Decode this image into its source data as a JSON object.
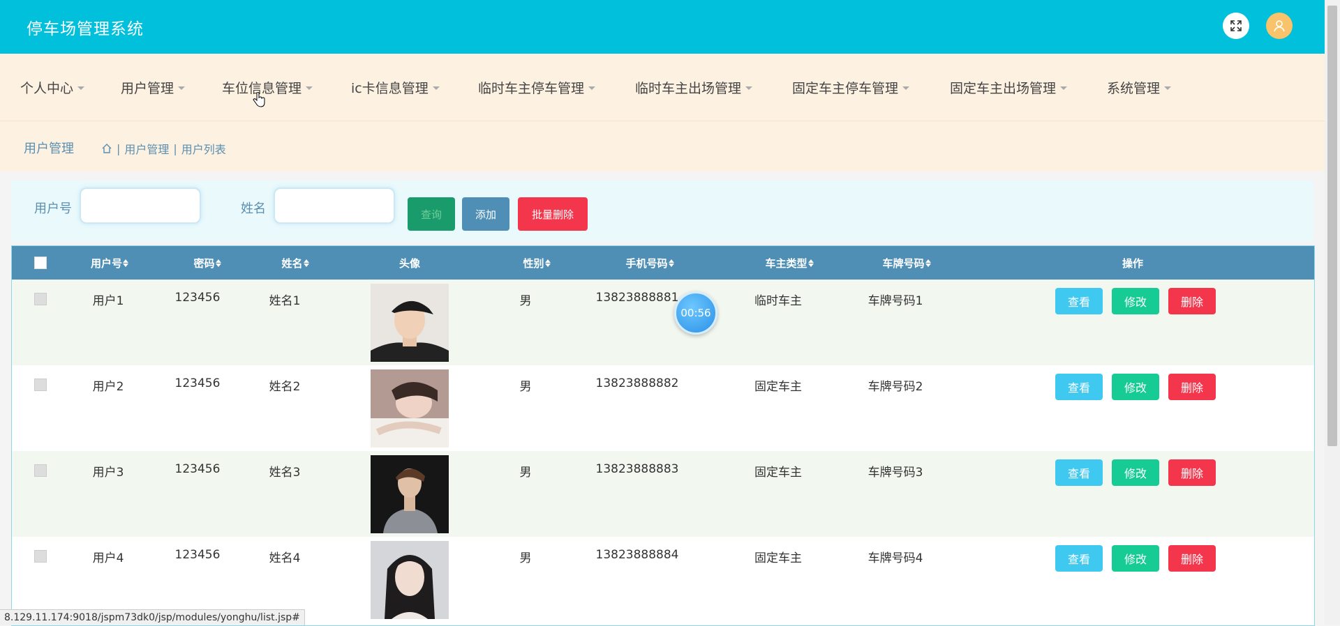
{
  "app": {
    "title": "停车场管理系统"
  },
  "menu": [
    {
      "label": "个人中心"
    },
    {
      "label": "用户管理"
    },
    {
      "label": "车位信息管理"
    },
    {
      "label": "ic卡信息管理"
    },
    {
      "label": "临时车主停车管理"
    },
    {
      "label": "临时车主出场管理"
    },
    {
      "label": "固定车主停车管理"
    },
    {
      "label": "固定车主出场管理"
    },
    {
      "label": "系统管理"
    }
  ],
  "breadcrumb": {
    "title": "用户管理",
    "path1": "用户管理",
    "path2": "用户列表"
  },
  "search": {
    "user_label": "用户号",
    "user_value": "",
    "name_label": "姓名",
    "name_value": "",
    "query_label": "查询",
    "add_label": "添加",
    "batch_delete_label": "批量删除"
  },
  "table": {
    "headers": [
      "用户号",
      "密码",
      "姓名",
      "头像",
      "性别",
      "手机号码",
      "车主类型",
      "车牌号码",
      "操作"
    ],
    "rows": [
      {
        "user": "用户1",
        "password": "123456",
        "name": "姓名1",
        "gender": "男",
        "phone": "13823888881",
        "type": "临时车主",
        "plate": "车牌号码1"
      },
      {
        "user": "用户2",
        "password": "123456",
        "name": "姓名2",
        "gender": "男",
        "phone": "13823888882",
        "type": "固定车主",
        "plate": "车牌号码2"
      },
      {
        "user": "用户3",
        "password": "123456",
        "name": "姓名3",
        "gender": "男",
        "phone": "13823888883",
        "type": "固定车主",
        "plate": "车牌号码3"
      },
      {
        "user": "用户4",
        "password": "123456",
        "name": "姓名4",
        "gender": "男",
        "phone": "13823888884",
        "type": "固定车主",
        "plate": "车牌号码4"
      }
    ],
    "actions": {
      "view": "查看",
      "edit": "修改",
      "delete": "删除"
    }
  },
  "timer": {
    "text": "00:56"
  },
  "status_url": "8.129.11.174:9018/jspm73dk0/jsp/modules/yonghu/list.jsp#",
  "colors": {
    "topbar": "#00c0dc",
    "menubar": "#fdf1e2",
    "table_header": "#4f8fb5",
    "view": "#3fc8f0",
    "edit": "#17cc94",
    "delete": "#f4364c"
  }
}
